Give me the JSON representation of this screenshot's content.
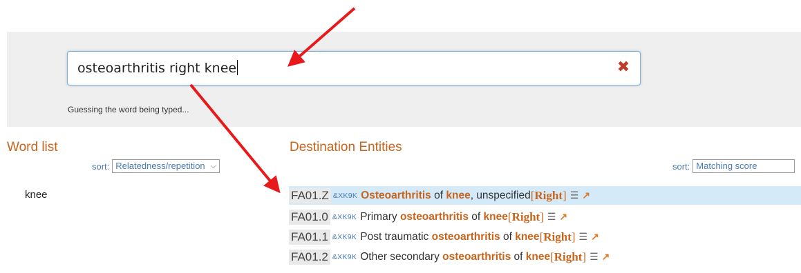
{
  "search": {
    "value": "osteoarthritis right knee",
    "hint": "Guessing the word being typed..."
  },
  "word_list": {
    "title": "Word list",
    "sort_label": "sort:",
    "sort_value": "Relatedness/repetition",
    "items": [
      "knee"
    ]
  },
  "destination": {
    "title": "Destination Entities",
    "sort_label": "sort:",
    "sort_value": "Matching score",
    "results": [
      {
        "code": "FA01.Z",
        "ext": "&XK9K",
        "selected": true,
        "parts": [
          [
            "hl",
            "Osteoarthritis"
          ],
          [
            "t",
            " of "
          ],
          [
            "hl",
            "knee"
          ],
          [
            "t",
            ", unspecified "
          ]
        ],
        "bracket": "Right"
      },
      {
        "code": "FA01.0",
        "ext": "&XK9K",
        "selected": false,
        "parts": [
          [
            "t",
            "Primary "
          ],
          [
            "hl",
            "osteoarthritis"
          ],
          [
            "t",
            " of "
          ],
          [
            "hl",
            "knee"
          ],
          [
            "t",
            " "
          ]
        ],
        "bracket": "Right"
      },
      {
        "code": "FA01.1",
        "ext": "&XK9K",
        "selected": false,
        "parts": [
          [
            "t",
            "Post traumatic "
          ],
          [
            "hl",
            "osteoarthritis"
          ],
          [
            "t",
            " of "
          ],
          [
            "hl",
            "knee"
          ],
          [
            "t",
            " "
          ]
        ],
        "bracket": "Right"
      },
      {
        "code": "FA01.2",
        "ext": "&XK9K",
        "selected": false,
        "parts": [
          [
            "t",
            "Other secondary "
          ],
          [
            "hl",
            "osteoarthritis"
          ],
          [
            "t",
            " of "
          ],
          [
            "hl",
            "knee"
          ],
          [
            "t",
            " "
          ]
        ],
        "bracket": "Right"
      }
    ]
  },
  "colors": {
    "accent": "#c8641b",
    "link": "#4a7ab5",
    "arrow": "#e8191a",
    "selected_row": "#d4eaf8"
  },
  "icons": {
    "clear": "close-x-icon",
    "list": "list-icon",
    "open": "open-external-icon"
  }
}
